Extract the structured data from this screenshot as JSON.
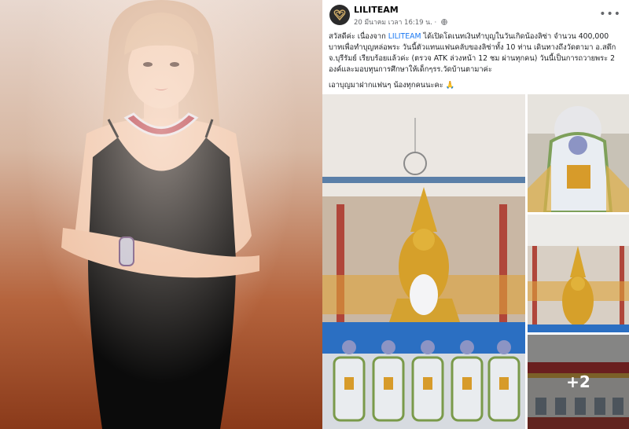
{
  "post": {
    "page_name": "LILITEAM",
    "timestamp": "20 มีนาคม เวลา 16:19 น.",
    "separator": "·",
    "paragraphs": [
      {
        "before": "สวัสดีค่ะ เนื่องจาก ",
        "mention": "LILITEAM",
        "after": " ได้เปิดโดเนทเงินทำบุญในวันเกิดน้องลิซ่า จำนวน 400,000 บาทเพื่อทำบุญหล่อพระ วันนี้ตัวแทนแฟนคลับของลิซ่าทั้ง 10 ท่าน เดินทางถึงวัดตามา อ.สตึก จ.บุรีรัมย์ เรียบร้อยแล้วค่ะ (ตรวจ ATK ล่วงหน้า 12 ชม ผ่านทุกคน) วันนี้เป็นการถวายพระ 2 องค์และมอบทุนการศึกษาให้เด็กๆรร.วัดบ้านตามาค่ะ"
      },
      {
        "text": "เอาบุญมาฝากแฟนๆ น้องทุกคนนะคะ 🙏"
      }
    ],
    "more_photos": "+2"
  },
  "icons": {
    "avatar": "liliteam-heart-logo",
    "globe": "globe-icon",
    "more": "more-options-icon"
  },
  "colors": {
    "mention": "#1877f2",
    "background_left": "#b5643d",
    "dress": "#0b0b0b"
  }
}
